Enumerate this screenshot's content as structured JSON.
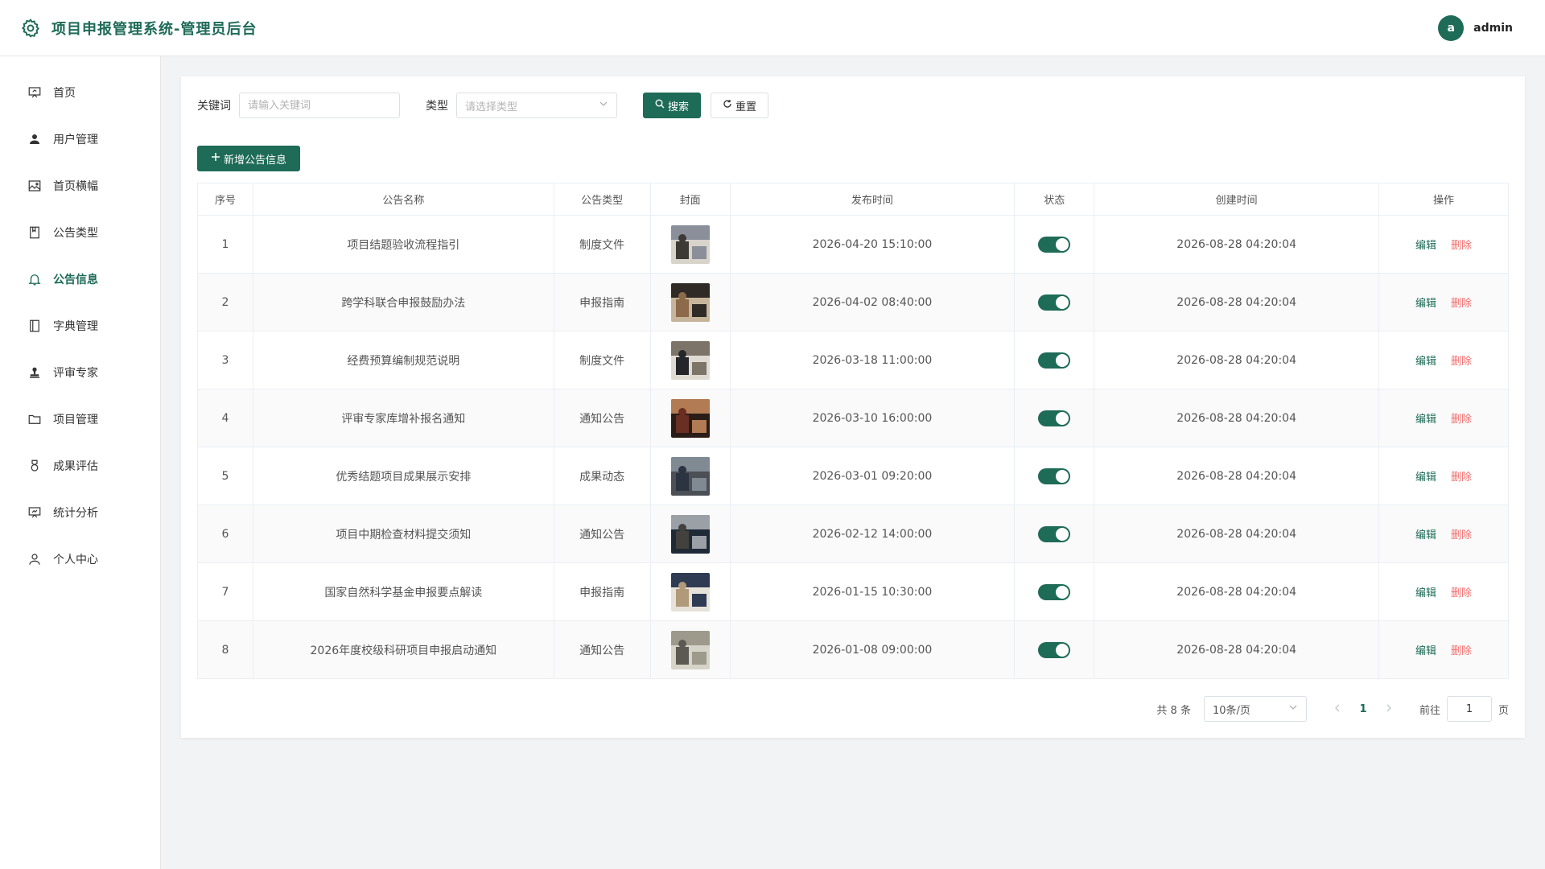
{
  "header": {
    "title": "项目申报管理系统-管理员后台",
    "avatar_letter": "a",
    "username": "admin"
  },
  "sidebar": {
    "items": [
      {
        "label": "首页",
        "icon": "presentation-icon"
      },
      {
        "label": "用户管理",
        "icon": "user-icon"
      },
      {
        "label": "首页横幅",
        "icon": "image-icon"
      },
      {
        "label": "公告类型",
        "icon": "bookmark-icon"
      },
      {
        "label": "公告信息",
        "icon": "bell-icon",
        "active": true
      },
      {
        "label": "字典管理",
        "icon": "notebook-icon"
      },
      {
        "label": "评审专家",
        "icon": "stamp-icon"
      },
      {
        "label": "项目管理",
        "icon": "folder-icon"
      },
      {
        "label": "成果评估",
        "icon": "medal-icon"
      },
      {
        "label": "统计分析",
        "icon": "chart-board-icon"
      },
      {
        "label": "个人中心",
        "icon": "user-outline-icon"
      }
    ]
  },
  "filters": {
    "keyword_label": "关键词",
    "keyword_placeholder": "请输入关键词",
    "type_label": "类型",
    "type_placeholder": "请选择类型",
    "search_label": "搜索",
    "reset_label": "重置"
  },
  "add_button_label": "新增公告信息",
  "table": {
    "columns": [
      "序号",
      "公告名称",
      "公告类型",
      "封面",
      "发布时间",
      "状态",
      "创建时间",
      "操作"
    ],
    "edit_label": "编辑",
    "delete_label": "删除",
    "rows": [
      {
        "no": "1",
        "name": "项目结题验收流程指引",
        "type": "制度文件",
        "publish": "2026-04-20 15:10:00",
        "created": "2026-08-28 04:20:04",
        "status": true
      },
      {
        "no": "2",
        "name": "跨学科联合申报鼓励办法",
        "type": "申报指南",
        "publish": "2026-04-02 08:40:00",
        "created": "2026-08-28 04:20:04",
        "status": true
      },
      {
        "no": "3",
        "name": "经费预算编制规范说明",
        "type": "制度文件",
        "publish": "2026-03-18 11:00:00",
        "created": "2026-08-28 04:20:04",
        "status": true
      },
      {
        "no": "4",
        "name": "评审专家库增补报名通知",
        "type": "通知公告",
        "publish": "2026-03-10 16:00:00",
        "created": "2026-08-28 04:20:04",
        "status": true
      },
      {
        "no": "5",
        "name": "优秀结题项目成果展示安排",
        "type": "成果动态",
        "publish": "2026-03-01 09:20:00",
        "created": "2026-08-28 04:20:04",
        "status": true
      },
      {
        "no": "6",
        "name": "项目中期检查材料提交须知",
        "type": "通知公告",
        "publish": "2026-02-12 14:00:00",
        "created": "2026-08-28 04:20:04",
        "status": true
      },
      {
        "no": "7",
        "name": "国家自然科学基金申报要点解读",
        "type": "申报指南",
        "publish": "2026-01-15 10:30:00",
        "created": "2026-08-28 04:20:04",
        "status": true
      },
      {
        "no": "8",
        "name": "2026年度校级科研项目申报启动通知",
        "type": "通知公告",
        "publish": "2026-01-08 09:00:00",
        "created": "2026-08-28 04:20:04",
        "status": true
      }
    ]
  },
  "pagination": {
    "total": "共 8 条",
    "page_size": "10条/页",
    "current_page": "1",
    "goto_label": "前往",
    "goto_value": "1",
    "page_suffix": "页"
  },
  "colors": {
    "primary": "#1e6b57",
    "danger": "#f56c6c"
  }
}
